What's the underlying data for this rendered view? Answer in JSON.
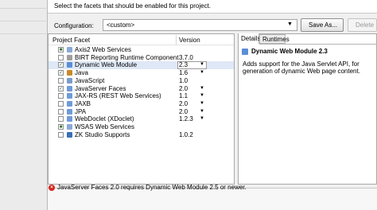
{
  "header": {
    "description": "Select the facets that should be enabled for this project."
  },
  "configuration": {
    "label": "Configuration:",
    "value": "<custom>",
    "save_as_label": "Save As...",
    "delete_label": "Delete"
  },
  "facets": {
    "col_facet": "Project Facet",
    "col_version": "Version",
    "rows": [
      {
        "name": "Axis2 Web Services",
        "version": "",
        "checked": "partial"
      },
      {
        "name": "BIRT Reporting Runtime Component",
        "version": "3.7.0",
        "checked": "no"
      },
      {
        "name": "Dynamic Web Module",
        "version": "2.3",
        "checked": "yes"
      },
      {
        "name": "Java",
        "version": "1.6",
        "checked": "yes"
      },
      {
        "name": "JavaScript",
        "version": "1.0",
        "checked": "no"
      },
      {
        "name": "JavaServer Faces",
        "version": "2.0",
        "checked": "yes"
      },
      {
        "name": "JAX-RS (REST Web Services)",
        "version": "1.1",
        "checked": "no"
      },
      {
        "name": "JAXB",
        "version": "2.0",
        "checked": "no"
      },
      {
        "name": "JPA",
        "version": "2.0",
        "checked": "no"
      },
      {
        "name": "WebDoclet (XDoclet)",
        "version": "1.2.3",
        "checked": "no"
      },
      {
        "name": "WSAS Web Services",
        "version": "",
        "checked": "partial"
      },
      {
        "name": "ZK Studio Supports",
        "version": "1.0.2",
        "checked": "no"
      }
    ]
  },
  "details": {
    "tab_details": "Details",
    "tab_runtimes": "Runtimes",
    "title": "Dynamic Web Module 2.3",
    "description": "Adds support for the Java Servlet API, for generation of dynamic Web page content."
  },
  "error": {
    "message": "JavaServer Faces 2.0 requires Dynamic Web Module 2.5 or newer."
  },
  "colors": {
    "selection": "#dfe8f6",
    "error": "#d8261d",
    "facet_icon": "#5b8ed6"
  }
}
